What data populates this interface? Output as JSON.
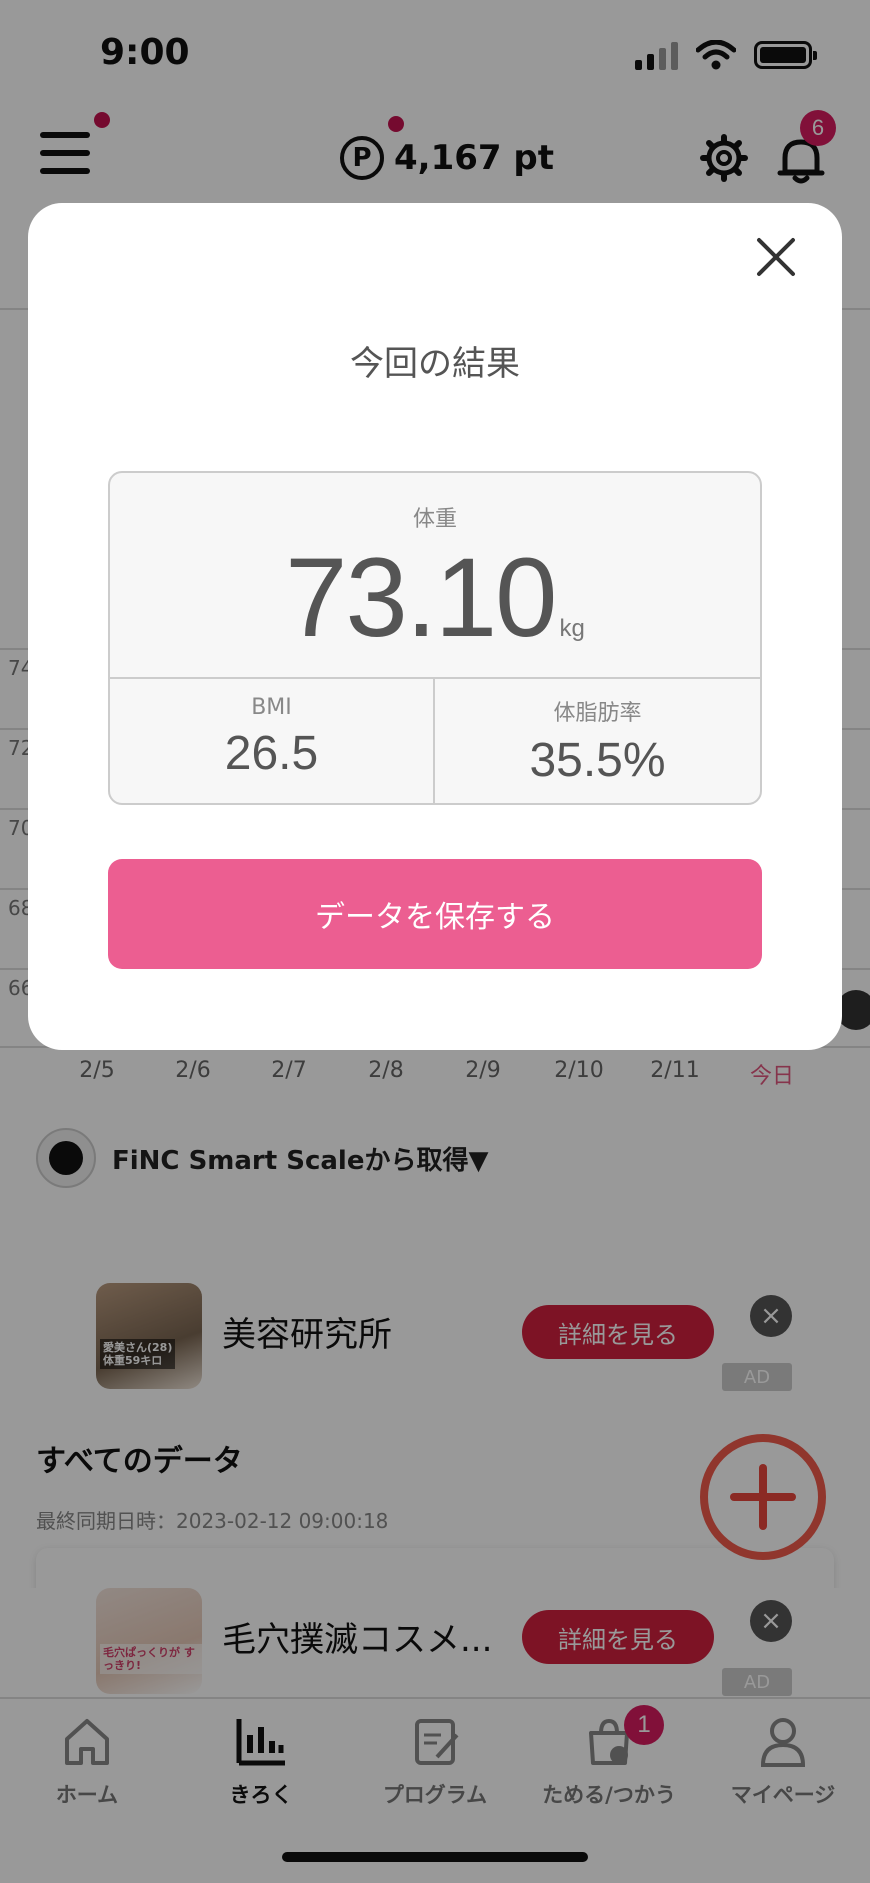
{
  "status": {
    "time": "9:00"
  },
  "header": {
    "points_symbol": "P",
    "points": "4,167 pt",
    "notification_count": "6"
  },
  "chart": {
    "y_labels": [
      "74",
      "72",
      "70",
      "68",
      "66"
    ],
    "x_labels": [
      "2/5",
      "2/6",
      "2/7",
      "2/8",
      "2/9",
      "2/10",
      "2/11",
      "今日"
    ]
  },
  "source": {
    "label": "FiNC Smart Scaleから取得▼"
  },
  "ads": [
    {
      "thumb_caption": "愛美さん(28)\n体重59キロ",
      "title": "美容研究所",
      "button": "詳細を見る",
      "label": "AD"
    },
    {
      "thumb_caption": "毛穴ぱっくりが\nすっきり!",
      "title": "毛穴撲滅コスメ...",
      "button": "詳細を見る",
      "label": "AD"
    }
  ],
  "all_data": {
    "title": "すべてのデータ",
    "last_sync": "最終同期日時：2023-02-12 09:00:18"
  },
  "tabbar": {
    "items": [
      {
        "label": "ホーム",
        "icon": "home-icon"
      },
      {
        "label": "きろく",
        "icon": "bar-chart-icon"
      },
      {
        "label": "プログラム",
        "icon": "clipboard-icon"
      },
      {
        "label": "ためる/つかう",
        "icon": "shopping-bag-icon",
        "badge": "1"
      },
      {
        "label": "マイページ",
        "icon": "person-icon"
      }
    ],
    "active_index": 1
  },
  "modal": {
    "title": "今回の結果",
    "weight_label": "体重",
    "weight_value": "73.10",
    "weight_unit": "kg",
    "bmi_label": "BMI",
    "bmi_value": "26.5",
    "bodyfat_label": "体脂肪率",
    "bodyfat_value": "35.5%",
    "save_button": "データを保存する"
  },
  "colors": {
    "accent_pink": "#ec5e91",
    "badge_red": "#d81b60",
    "ad_button_red": "#d0203e"
  }
}
